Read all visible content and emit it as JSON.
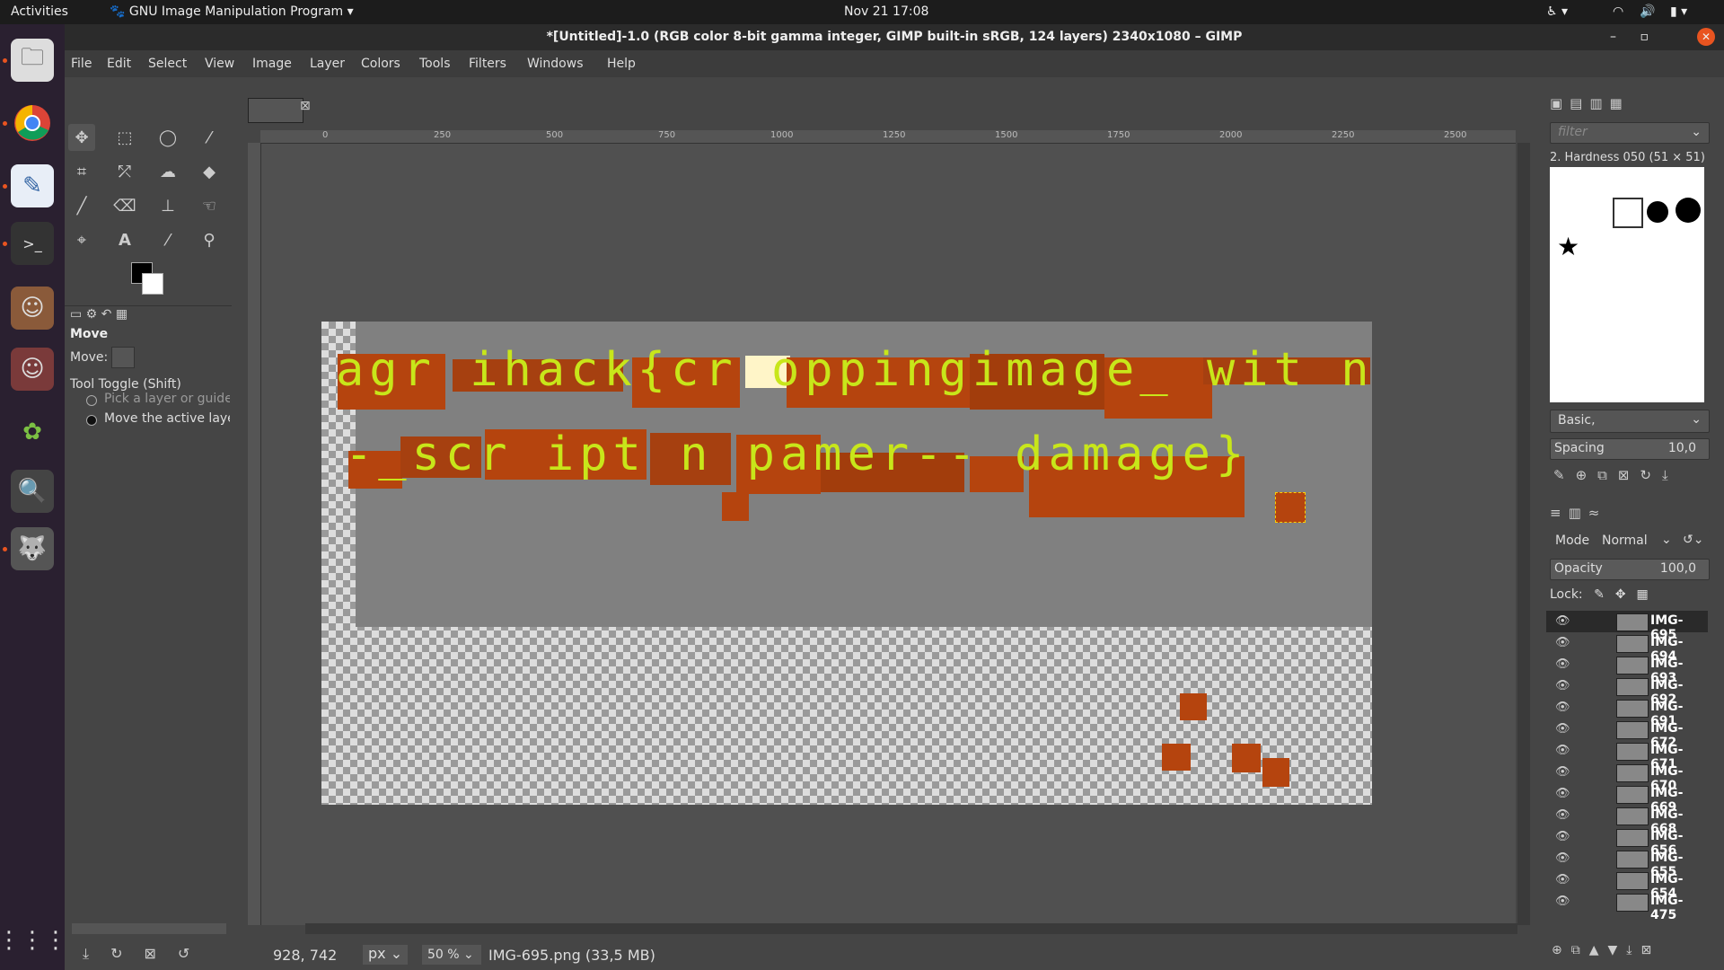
{
  "topbar": {
    "activities": "Activities",
    "app_menu": "GNU Image Manipulation Program",
    "clock": "Nov 21  17:08"
  },
  "window": {
    "title": "*[Untitled]-1.0 (RGB color 8-bit gamma integer, GIMP built-in sRGB, 124 layers) 2340x1080 – GIMP"
  },
  "menu": [
    "File",
    "Edit",
    "Select",
    "View",
    "Image",
    "Layer",
    "Colors",
    "Tools",
    "Filters",
    "Windows",
    "Help"
  ],
  "tool_options": {
    "title": "Move",
    "move_label": "Move:",
    "toggle_label": "Tool Toggle  (Shift)",
    "option1": "Pick a layer or guide",
    "option2": "Move the active layer"
  },
  "ruler_ticks": [
    "0",
    "250",
    "500",
    "750",
    "1000",
    "1250",
    "1500",
    "1750",
    "2000",
    "2250",
    "2500"
  ],
  "canvas_text": {
    "line1": "agr ihack{cr oppingimage_ wit n",
    "line2": "-_scr ipt n pamer-- damage}"
  },
  "brushes": {
    "filter_placeholder": "filter",
    "current": "2. Hardness 050 (51 × 51)",
    "preset": "Basic,",
    "spacing_label": "Spacing",
    "spacing_value": "10,0"
  },
  "layers_panel": {
    "mode_label": "Mode",
    "mode_value": "Normal",
    "opacity_label": "Opacity",
    "opacity_value": "100,0",
    "lock_label": "Lock:",
    "layers": [
      "IMG-695",
      "IMG-694",
      "IMG-693",
      "IMG-692",
      "IMG-691",
      "IMG-672",
      "IMG-671",
      "IMG-670",
      "IMG-669",
      "IMG-668",
      "IMG-656",
      "IMG-655",
      "IMG-654",
      "IMG-475"
    ]
  },
  "statusbar": {
    "coords": "928, 742",
    "unit": "px",
    "zoom": "50 %",
    "info": "IMG-695.png (33,5 MB)"
  }
}
